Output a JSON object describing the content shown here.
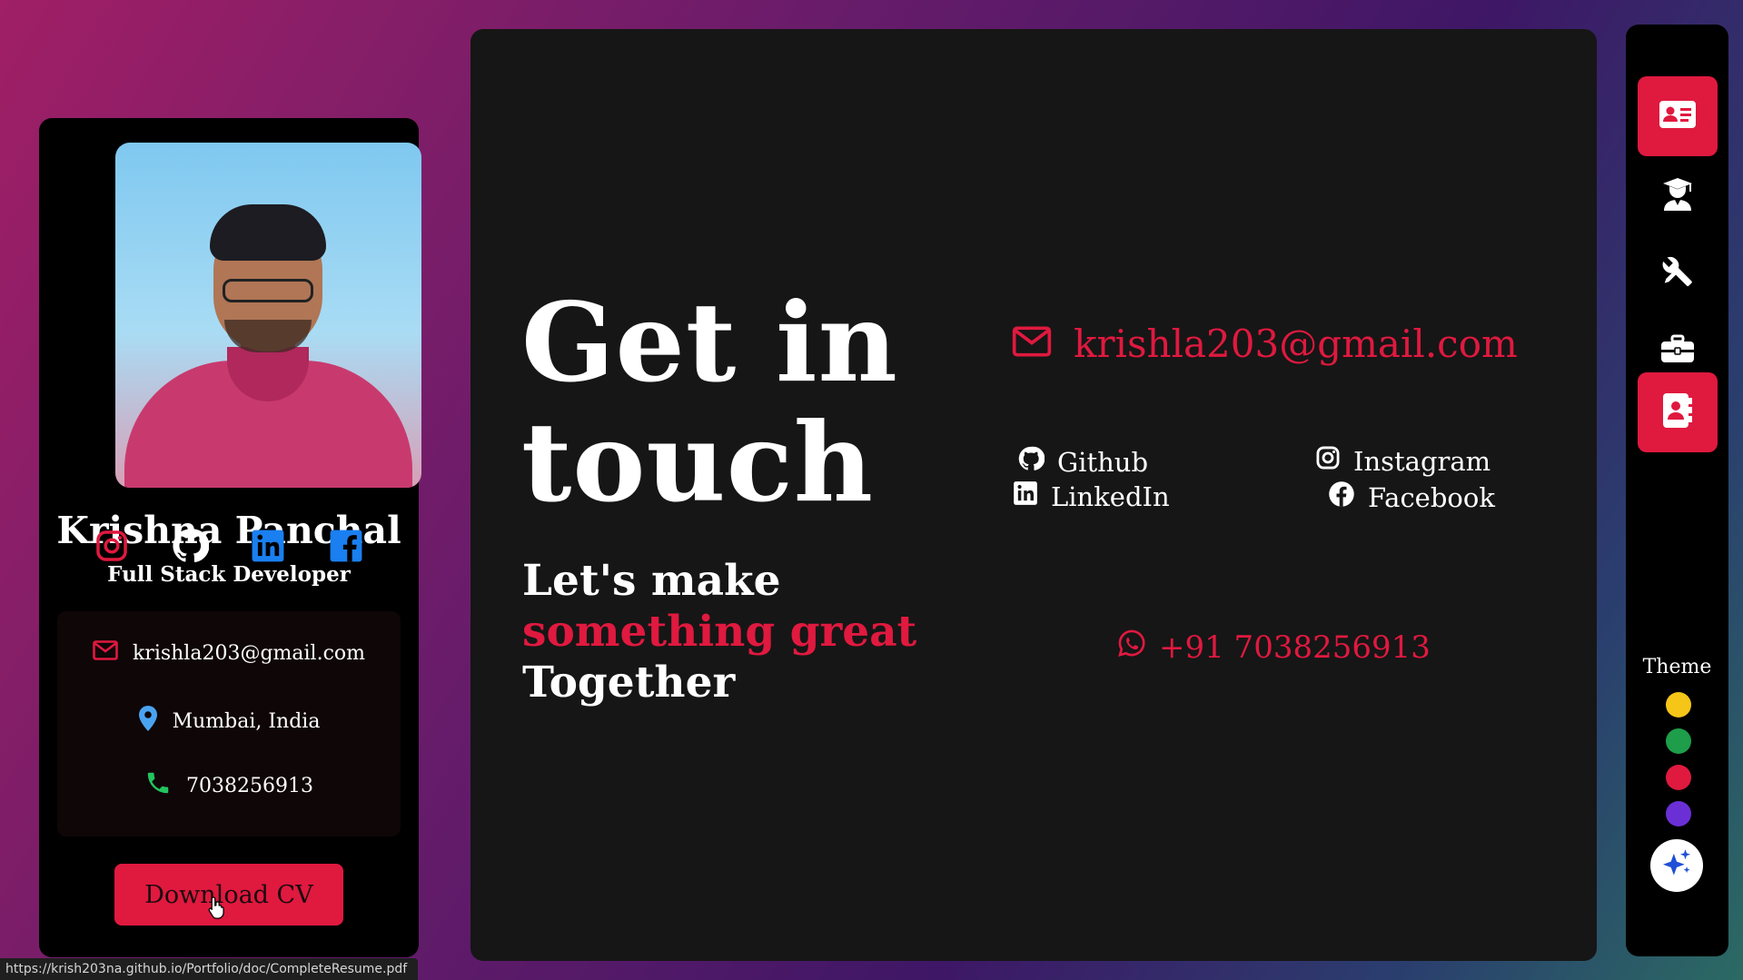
{
  "profile": {
    "name": "Krishna Panchal",
    "role": "Full Stack Developer",
    "social_icons": [
      "instagram-icon",
      "github-icon",
      "linkedin-icon",
      "facebook-icon"
    ],
    "contact": {
      "email": "krishla203@gmail.com",
      "location": "Mumbai, India",
      "phone": "7038256913"
    },
    "download_label": "Download CV"
  },
  "main": {
    "heading_line1": "Get in",
    "heading_line2": "touch",
    "tagline_line1": "Let's make",
    "tagline_line2": "something great",
    "tagline_line3": "Together",
    "email": "krishla203@gmail.com",
    "links": {
      "github": "Github",
      "instagram": "Instagram",
      "linkedin": "LinkedIn",
      "facebook": "Facebook"
    },
    "whatsapp": "+91 7038256913"
  },
  "nav": {
    "items": [
      "profile-card-icon",
      "graduation-icon",
      "tools-icon",
      "briefcase-icon",
      "contact-book-icon"
    ],
    "theme_label": "Theme",
    "theme_colors": [
      "#f5c518",
      "#1e9e4a",
      "#e0193f",
      "#6b2fd6"
    ]
  },
  "colors": {
    "accent": "#e0193f",
    "panel": "#161616",
    "card": "#000000"
  },
  "status_bar": {
    "url": "https://krish203na.github.io/Portfolio/doc/CompleteResume.pdf"
  }
}
